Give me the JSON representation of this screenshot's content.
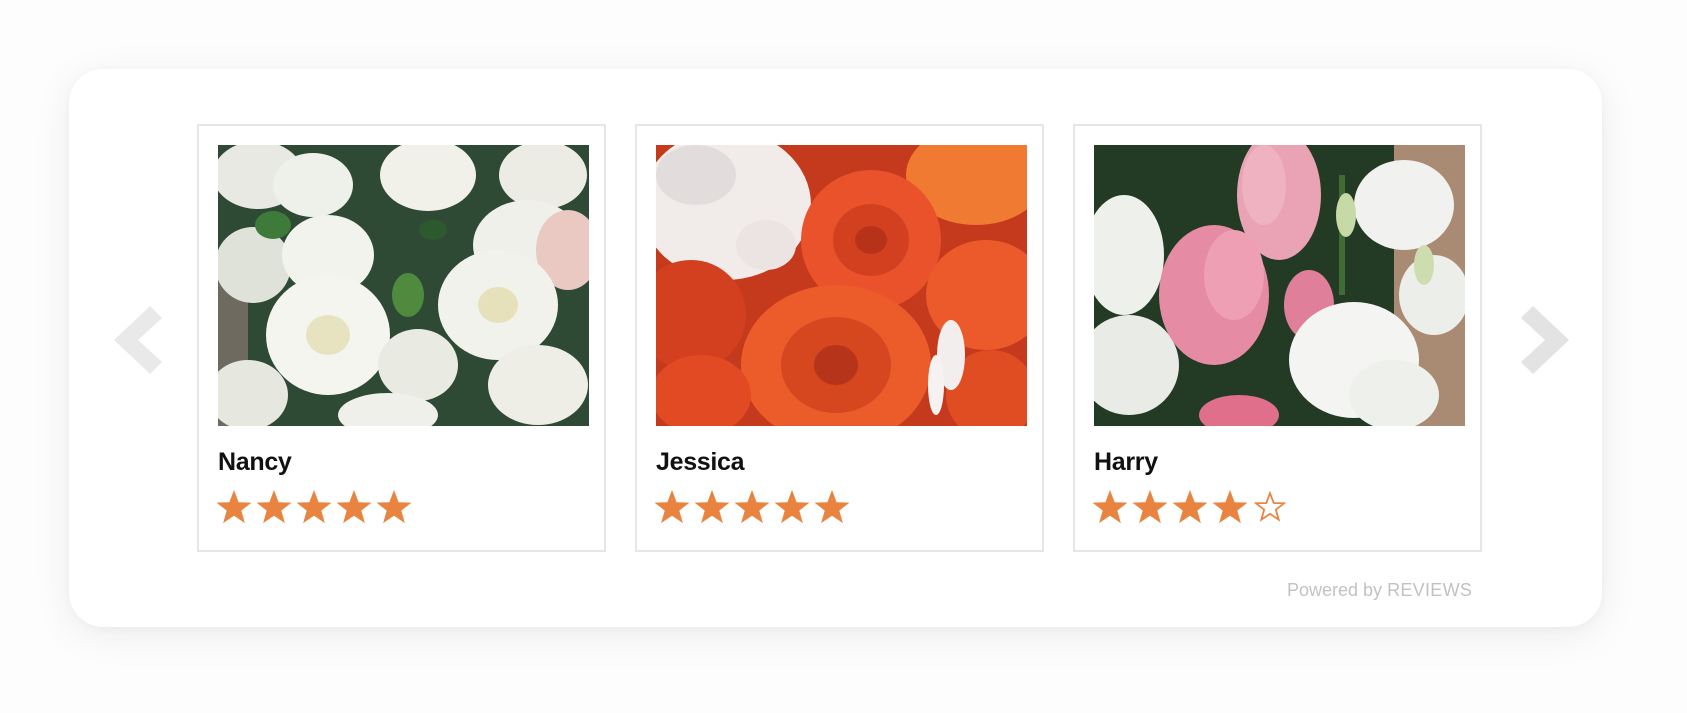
{
  "widget": {
    "powered_by_prefix": "Powered by",
    "powered_by_brand": "REVIEWS",
    "accent_color": "#e8843f",
    "prev_icon": "chevron-left-icon",
    "next_icon": "chevron-right-icon"
  },
  "reviews": [
    {
      "name": "Nancy",
      "rating": 5,
      "max_rating": 5,
      "photo": "white-roses-bouquet"
    },
    {
      "name": "Jessica",
      "rating": 5,
      "max_rating": 5,
      "photo": "orange-roses-with-babys-breath"
    },
    {
      "name": "Harry",
      "rating": 4,
      "max_rating": 5,
      "photo": "pink-and-white-lisianthus-bouquet"
    }
  ]
}
